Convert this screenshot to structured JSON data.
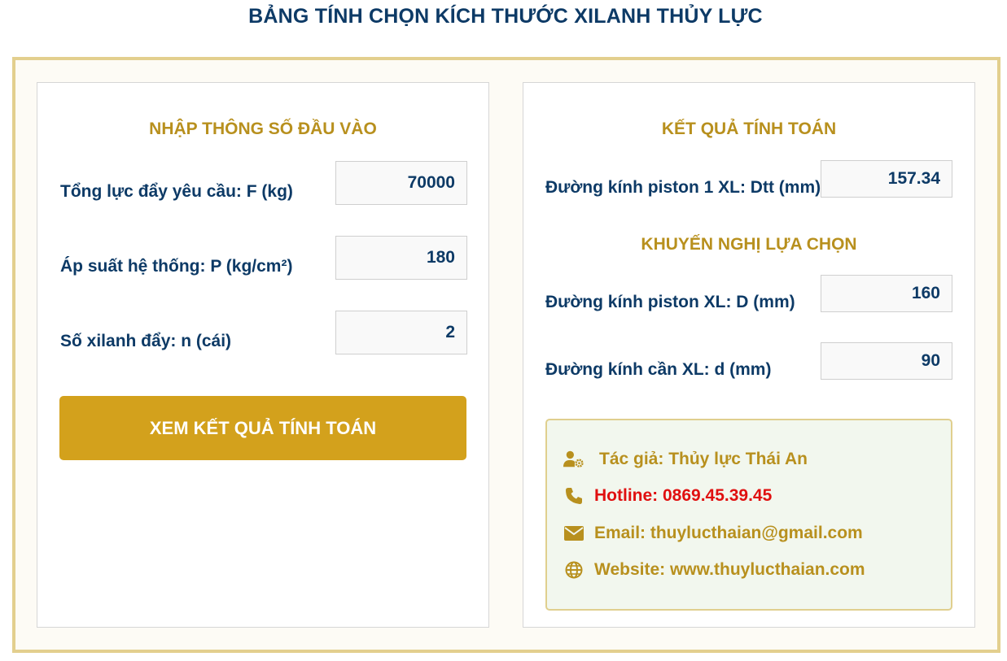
{
  "page": {
    "title": "BẢNG TÍNH CHỌN KÍCH THƯỚC XILANH THỦY LỰC"
  },
  "input_panel": {
    "heading": "NHẬP THÔNG SỐ ĐẦU VÀO",
    "fields": [
      {
        "label": "Tổng lực đẩy yêu cầu: F (kg)",
        "value": "70000"
      },
      {
        "label": "Áp suất hệ thống: P (kg/cm²)",
        "value": "180"
      },
      {
        "label": "Số xilanh đẩy: n (cái)",
        "value": "2"
      }
    ],
    "button_label": "XEM KẾT QUẢ TÍNH TOÁN"
  },
  "result_panel": {
    "heading": "KẾT QUẢ TÍNH TOÁN",
    "computed": {
      "label": "Đường kính piston 1 XL: Dtt (mm)",
      "value": "157.34"
    },
    "recommend_heading": "KHUYẾN NGHỊ LỰA CHỌN",
    "recommendations": [
      {
        "label": "Đường kính piston XL: D (mm)",
        "value": "160"
      },
      {
        "label": "Đường kính cần XL: d (mm)",
        "value": "90"
      }
    ]
  },
  "contact": {
    "author": "Tác giả: Thủy lực Thái An",
    "hotline": "Hotline: 0869.45.39.45",
    "email": "Email: thuylucthaian@gmail.com",
    "website": "Website: www.thuylucthaian.com",
    "icons": [
      "user-cog-icon",
      "phone-icon",
      "envelope-icon",
      "globe-icon"
    ]
  },
  "colors": {
    "navy": "#0d3a66",
    "gold": "#b8901e",
    "button": "#d3a11c",
    "frame": "#e3cf8e",
    "hotline_red": "#e01010",
    "card_bg": "#f2f7ee"
  }
}
